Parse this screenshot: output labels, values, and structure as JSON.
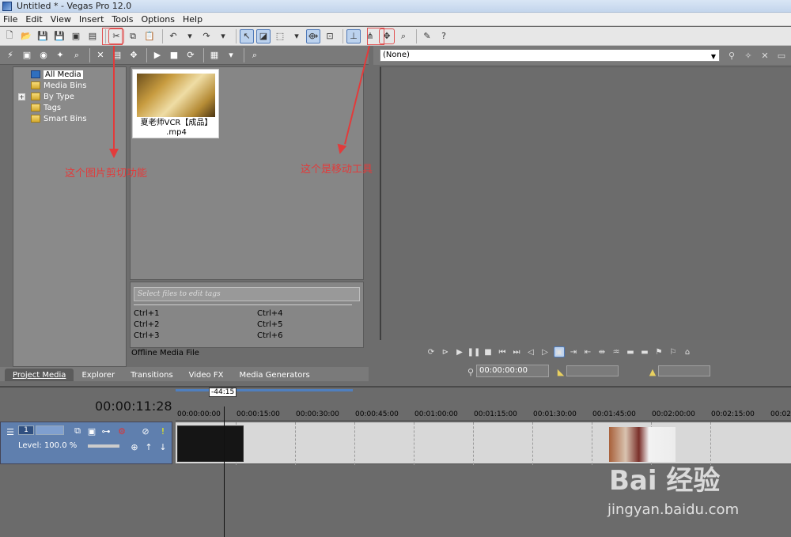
{
  "window": {
    "title": "Untitled * - Vegas Pro 12.0"
  },
  "menu": [
    "File",
    "Edit",
    "View",
    "Insert",
    "Tools",
    "Options",
    "Help"
  ],
  "tree": {
    "items": [
      {
        "label": "All Media",
        "selected": true
      },
      {
        "label": "Media Bins"
      },
      {
        "label": "By Type",
        "expandable": true
      },
      {
        "label": "Tags"
      },
      {
        "label": "Smart Bins"
      }
    ]
  },
  "media": {
    "file_label_line1": "夏老师VCR【成品】",
    "file_label_line2": ".mp4"
  },
  "tags": {
    "placeholder": "Select files to edit tags",
    "shortcuts": [
      "Ctrl+1",
      "Ctrl+4",
      "Ctrl+2",
      "Ctrl+5",
      "Ctrl+3",
      "Ctrl+6"
    ],
    "offline_label": "Offline Media File"
  },
  "tabs": [
    "Project Media",
    "Explorer",
    "Transitions",
    "Video FX",
    "Media Generators"
  ],
  "preview": {
    "selector_value": "(None)",
    "timecode": "00:00:00:00"
  },
  "timeline": {
    "current_time": "00:00:11:28",
    "marker": "-44:15",
    "ruler": [
      "00:00:00:00",
      "00:00:15:00",
      "00:00:30:00",
      "00:00:45:00",
      "00:01:00:00",
      "00:01:15:00",
      "00:01:30:00",
      "00:01:45:00",
      "00:02:00:00",
      "00:02:15:00",
      "00:02"
    ],
    "track_number": "1",
    "track_level": "Level: 100.0 %"
  },
  "annotations": {
    "cut_tool": "这个图片剪切功能",
    "move_tool": "这个是移动工具"
  },
  "watermark": {
    "brand": "Bai  经验",
    "url": "jingyan.baidu.com"
  },
  "colors": {
    "annotation": "#e23b3b",
    "track_header": "#5f7fae"
  }
}
